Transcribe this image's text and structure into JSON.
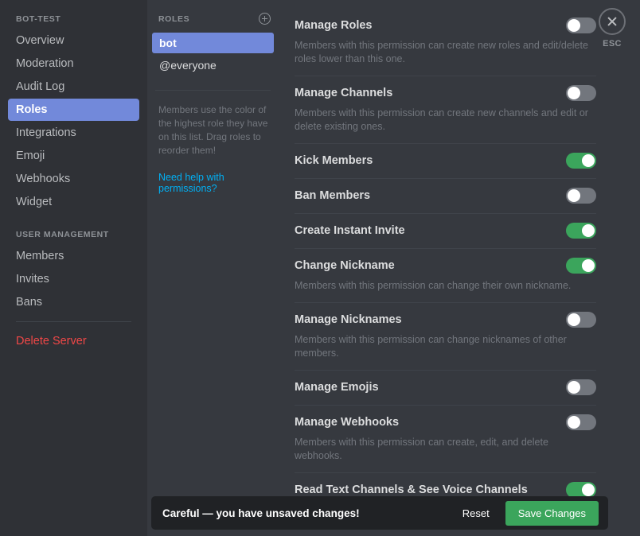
{
  "sidebar": {
    "server_header": "BOT-TEST",
    "items": [
      {
        "label": "Overview",
        "active": false
      },
      {
        "label": "Moderation",
        "active": false
      },
      {
        "label": "Audit Log",
        "active": false
      },
      {
        "label": "Roles",
        "active": true
      },
      {
        "label": "Integrations",
        "active": false
      },
      {
        "label": "Emoji",
        "active": false
      },
      {
        "label": "Webhooks",
        "active": false
      },
      {
        "label": "Widget",
        "active": false
      }
    ],
    "user_management_header": "USER MANAGEMENT",
    "user_items": [
      {
        "label": "Members"
      },
      {
        "label": "Invites"
      },
      {
        "label": "Bans"
      }
    ],
    "delete_server": "Delete Server"
  },
  "roles_panel": {
    "header": "ROLES",
    "add_icon": "plus-circle-icon",
    "roles": [
      {
        "name": "bot",
        "selected": true
      },
      {
        "name": "@everyone",
        "selected": false
      }
    ],
    "note": "Members use the color of the highest role they have on this list. Drag roles to reorder them!",
    "help_link": "Need help with permissions?"
  },
  "permissions": [
    {
      "label": "Manage Roles",
      "description": "Members with this permission can create new roles and edit/delete roles lower than this one.",
      "enabled": false
    },
    {
      "label": "Manage Channels",
      "description": "Members with this permission can create new channels and edit or delete existing ones.",
      "enabled": false
    },
    {
      "label": "Kick Members",
      "description": "",
      "enabled": true
    },
    {
      "label": "Ban Members",
      "description": "",
      "enabled": false
    },
    {
      "label": "Create Instant Invite",
      "description": "",
      "enabled": true
    },
    {
      "label": "Change Nickname",
      "description": "Members with this permission can change their own nickname.",
      "enabled": true
    },
    {
      "label": "Manage Nicknames",
      "description": "Members with this permission can change nicknames of other members.",
      "enabled": false
    },
    {
      "label": "Manage Emojis",
      "description": "",
      "enabled": false
    },
    {
      "label": "Manage Webhooks",
      "description": "Members with this permission can create, edit, and delete webhooks.",
      "enabled": false
    },
    {
      "label": "Read Text Channels & See Voice Channels",
      "description": "",
      "enabled": true
    }
  ],
  "close": {
    "icon": "close-x-icon",
    "label": "ESC"
  },
  "savebar": {
    "message": "Careful — you have unsaved changes!",
    "reset_label": "Reset",
    "save_label": "Save Changes"
  },
  "colors": {
    "accent_blurple": "#7289da",
    "toggle_on_green": "#3ba55c",
    "toggle_off_gray": "#72767d",
    "link_blue": "#00b0f4",
    "danger_red": "#f04747",
    "sidebar_bg": "#2f3136",
    "content_bg": "#36393f",
    "savebar_bg": "#202225"
  }
}
